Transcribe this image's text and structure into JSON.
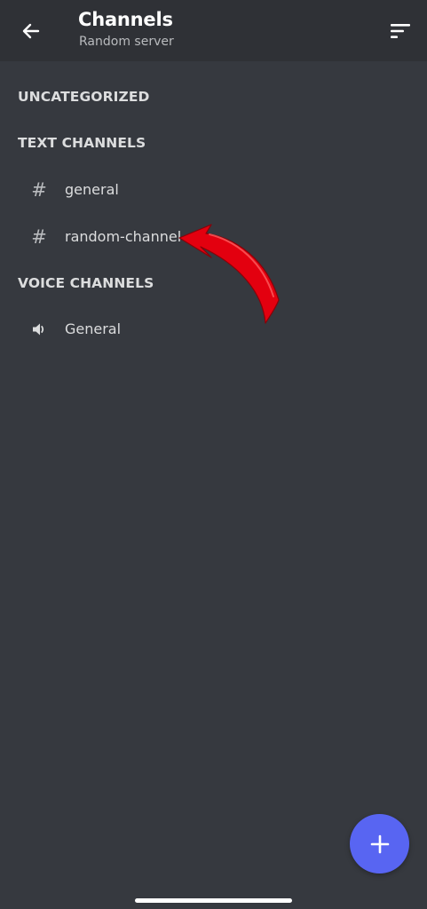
{
  "header": {
    "title": "Channels",
    "subtitle": "Random server",
    "back_icon": "arrow-left-icon",
    "sort_icon": "sort-icon"
  },
  "categories": [
    {
      "label": "UNCATEGORIZED"
    },
    {
      "label": "TEXT CHANNELS"
    },
    {
      "label": "VOICE CHANNELS"
    }
  ],
  "channels": [
    {
      "label": "general",
      "type": "text",
      "icon": "hash-icon"
    },
    {
      "label": "random-channel",
      "type": "text",
      "icon": "hash-icon"
    },
    {
      "label": "General",
      "type": "voice",
      "icon": "speaker-icon"
    }
  ],
  "hash_glyph": "#",
  "fab": {
    "icon": "plus-icon",
    "color": "#5865f2"
  },
  "colors": {
    "background": "#36393f",
    "header": "#2f3136",
    "annotation_arrow": "#e3000f"
  }
}
